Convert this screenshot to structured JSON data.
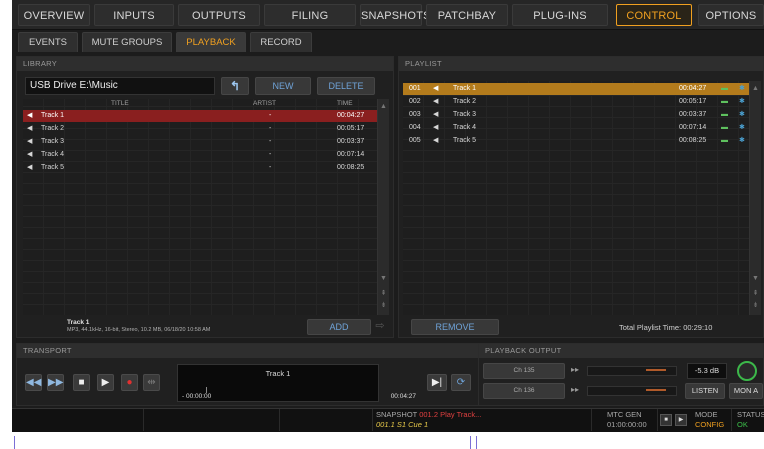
{
  "topnav": [
    "OVERVIEW",
    "INPUTS",
    "OUTPUTS",
    "FILING",
    "SNAPSHOTS",
    "PATCHBAY",
    "PLUG-INS",
    "CONTROL",
    "OPTIONS"
  ],
  "subnav": [
    "EVENTS",
    "MUTE GROUPS",
    "PLAYBACK",
    "RECORD"
  ],
  "library": {
    "header": "LIBRARY",
    "path": "USB Drive E:\\Music",
    "up_icon": "arrow-up-icon",
    "new_label": "NEW",
    "delete_label": "DELETE",
    "col_title": "TITLE",
    "col_artist": "ARTIST",
    "col_time": "TIME",
    "tracks": [
      {
        "title": "Track 1",
        "artist": "-",
        "time": "00:04:27"
      },
      {
        "title": "Track 2",
        "artist": "-",
        "time": "00:05:17"
      },
      {
        "title": "Track 3",
        "artist": "-",
        "time": "00:03:37"
      },
      {
        "title": "Track 4",
        "artist": "-",
        "time": "00:07:14"
      },
      {
        "title": "Track 5",
        "artist": "-",
        "time": "00:08:25"
      }
    ],
    "info_title": "Track 1",
    "info_detail": "MP3, 44.1kHz, 16-bit, Stereo, 10.2 MB, 06/18/20 10:58 AM",
    "add_label": "ADD"
  },
  "playlist": {
    "header": "PLAYLIST",
    "items": [
      {
        "num": "001",
        "title": "Track 1",
        "time": "00:04:27"
      },
      {
        "num": "002",
        "title": "Track 2",
        "time": "00:05:17"
      },
      {
        "num": "003",
        "title": "Track 3",
        "time": "00:03:37"
      },
      {
        "num": "004",
        "title": "Track 4",
        "time": "00:07:14"
      },
      {
        "num": "005",
        "title": "Track 5",
        "time": "00:08:25"
      }
    ],
    "remove_label": "REMOVE",
    "total_label": "Total Playlist Time:",
    "total_time": "00:29:10"
  },
  "transport": {
    "header": "TRANSPORT",
    "track": "Track 1",
    "elapsed": "- 00:00:00",
    "duration": "00:04:27"
  },
  "playback_output": {
    "header": "PLAYBACK OUTPUT",
    "ch1": "Ch 135",
    "ch2": "Ch 136",
    "gain": "-5.3 dB",
    "listen": "LISTEN",
    "mon": "MON A"
  },
  "status": {
    "snapshot_label": "SNAPSHOT",
    "snapshot_value": "001.2 Play Track...",
    "snapshot_cue": "001.1 S1 Cue 1",
    "mtc_label": "MTC GEN",
    "mtc_value": "01:00:00:00",
    "mode_label": "MODE",
    "mode_value": "CONFIG",
    "status_label": "STATUS",
    "status_value": "OK"
  },
  "colors": {
    "accent": "#f0a020",
    "selected_row": "#8a1f1f",
    "playlist_selected": "#b37b1c",
    "button_text": "#6fa3d8"
  }
}
